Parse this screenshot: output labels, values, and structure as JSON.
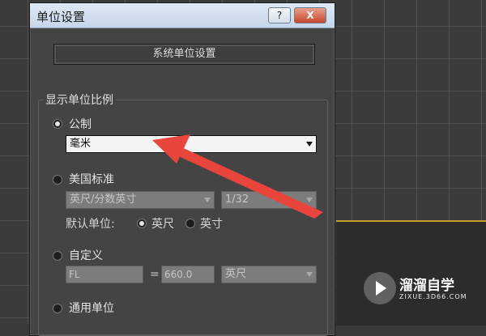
{
  "dialog": {
    "title": "单位设置",
    "help_label": "?",
    "close_label": "X",
    "system_units_button": "系统单位设置"
  },
  "display_scale": {
    "group_label": "显示单位比例",
    "metric": {
      "label": "公制",
      "selected": true,
      "value": "毫米"
    },
    "us_standard": {
      "label": "美国标准",
      "selected": false,
      "unit_value": "英尺/分数英寸",
      "fraction_value": "1/32",
      "default_units_label": "默认单位:",
      "option_feet": "英尺",
      "option_inches": "英寸",
      "default_selected": "英尺"
    },
    "custom": {
      "label": "自定义",
      "selected": false,
      "name_value": "FL",
      "equals": "=",
      "amount_value": "660.0",
      "unit_value": "英尺"
    },
    "generic": {
      "label": "通用单位",
      "selected": false
    }
  },
  "watermark": {
    "brand": "溜溜自学",
    "url": "ZIXUE.3D66.COM"
  },
  "colors": {
    "arrow": "#e8453c",
    "accent": "#c9a227"
  }
}
